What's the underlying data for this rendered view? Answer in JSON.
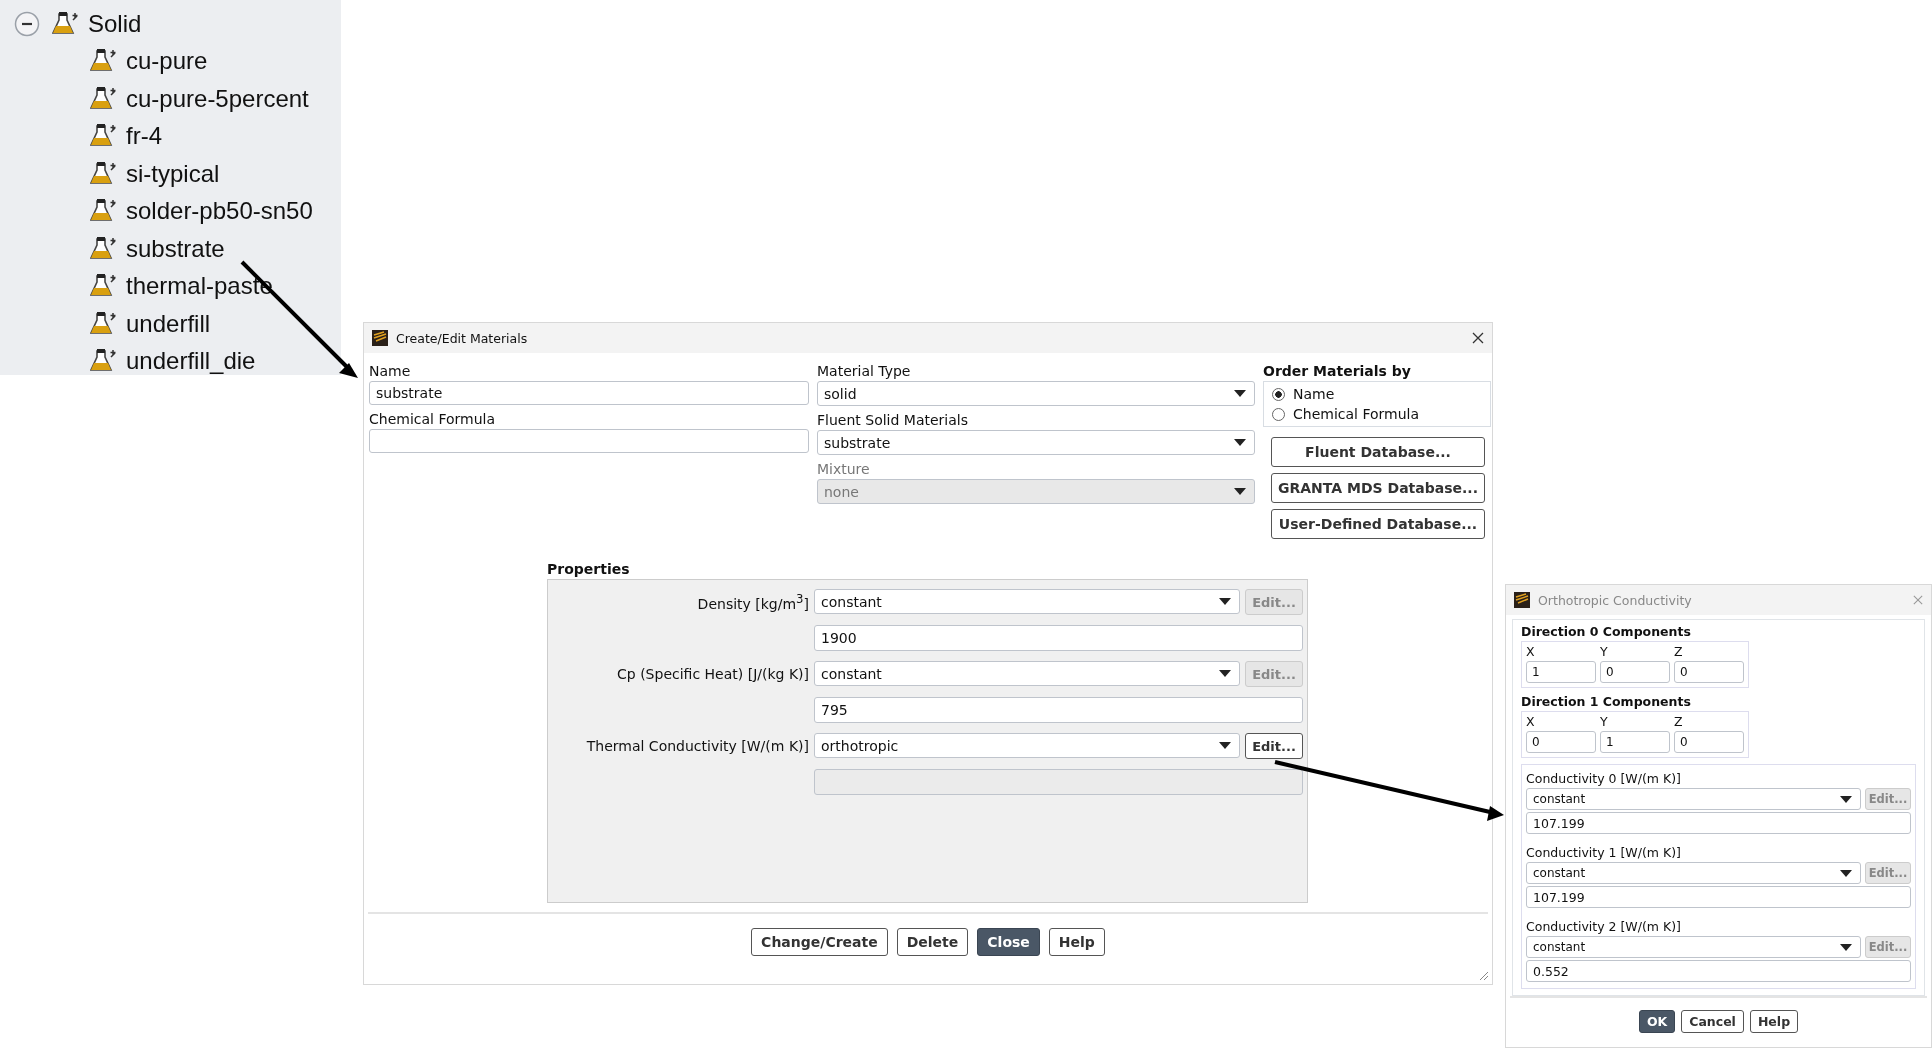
{
  "tree": {
    "label": "Solid",
    "expanded": true,
    "children": [
      {
        "label": "cu-pure"
      },
      {
        "label": "cu-pure-5percent"
      },
      {
        "label": "fr-4"
      },
      {
        "label": "si-typical"
      },
      {
        "label": "solder-pb50-sn50"
      },
      {
        "label": "substrate"
      },
      {
        "label": "thermal-paste"
      },
      {
        "label": "underfill"
      },
      {
        "label": "underfill_die"
      }
    ]
  },
  "materials_dialog": {
    "title": "Create/Edit Materials",
    "name": {
      "label": "Name",
      "value": "substrate"
    },
    "chemical_formula": {
      "label": "Chemical Formula"
    },
    "dropdowns": [
      {
        "label": "Material Type",
        "value": "solid",
        "disabled": false
      },
      {
        "label": "Fluent Solid Materials",
        "value": "substrate",
        "disabled": false
      },
      {
        "label": "Mixture",
        "value": "none",
        "disabled": true
      }
    ],
    "order_by": {
      "title": "Order Materials by",
      "options": [
        {
          "label": "Name",
          "selected": true
        },
        {
          "label": "Chemical Formula",
          "selected": false
        }
      ]
    },
    "database_buttons": [
      "Fluent Database...",
      "GRANTA MDS Database...",
      "User-Defined Database..."
    ],
    "properties": {
      "title": "Properties",
      "rows": [
        {
          "label": "Density [kg/m$^{3}$]",
          "method": "constant",
          "edit": {
            "label": "Edit...",
            "disabled": true
          },
          "value": "1900",
          "value_disabled": false
        },
        {
          "label": "Cp (Specific Heat) [J/(kg K)]",
          "method": "constant",
          "edit": {
            "label": "Edit...",
            "disabled": true
          },
          "value": "795",
          "value_disabled": false
        },
        {
          "label": "Thermal Conductivity [W/(m K)]",
          "method": "orthotropic",
          "edit": {
            "label": "Edit...",
            "disabled": false
          },
          "value_disabled": true
        }
      ]
    },
    "buttons": [
      {
        "label": "Change/Create",
        "default": false
      },
      {
        "label": "Delete",
        "default": false
      },
      {
        "label": "Close",
        "default": true
      },
      {
        "label": "Help",
        "default": false
      }
    ]
  },
  "conductivity_dialog": {
    "title": "Orthotropic Conductivity",
    "directions": [
      {
        "title": "Direction 0 Components",
        "components": [
          {
            "axis": "X",
            "value": "1"
          },
          {
            "axis": "Y",
            "value": "0"
          },
          {
            "axis": "Z",
            "value": "0"
          }
        ]
      },
      {
        "title": "Direction 1 Components",
        "components": [
          {
            "axis": "X",
            "value": "0"
          },
          {
            "axis": "Y",
            "value": "1"
          },
          {
            "axis": "Z",
            "value": "0"
          }
        ]
      }
    ],
    "conductivities": [
      {
        "label": "Conductivity 0 [W/(m K)]",
        "method": "constant",
        "edit": {
          "label": "Edit...",
          "disabled": true
        },
        "value": "107.199"
      },
      {
        "label": "Conductivity 1 [W/(m K)]",
        "method": "constant",
        "edit": {
          "label": "Edit...",
          "disabled": true
        },
        "value": "107.199"
      },
      {
        "label": "Conductivity 2 [W/(m K)]",
        "method": "constant",
        "edit": {
          "label": "Edit...",
          "disabled": true
        },
        "value": "0.552"
      }
    ],
    "buttons": [
      {
        "label": "OK",
        "default": true
      },
      {
        "label": "Cancel",
        "default": false
      },
      {
        "label": "Help",
        "default": false
      }
    ]
  }
}
